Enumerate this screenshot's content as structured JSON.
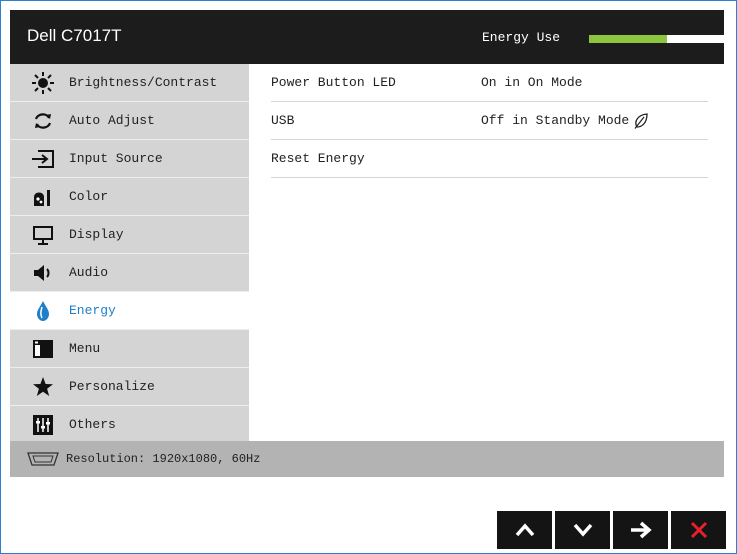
{
  "header": {
    "title": "Dell C7017T",
    "energy_use_label": "Energy Use",
    "energy_use_level": 0.58
  },
  "sidebar": {
    "items": [
      {
        "label": "Brightness/Contrast",
        "icon": "brightness-icon"
      },
      {
        "label": "Auto Adjust",
        "icon": "auto-adjust-icon"
      },
      {
        "label": "Input Source",
        "icon": "input-source-icon"
      },
      {
        "label": "Color",
        "icon": "color-icon"
      },
      {
        "label": "Display",
        "icon": "display-icon"
      },
      {
        "label": "Audio",
        "icon": "speaker-icon"
      },
      {
        "label": "Energy",
        "icon": "energy-drop-icon",
        "active": true
      },
      {
        "label": "Menu",
        "icon": "menu-icon"
      },
      {
        "label": "Personalize",
        "icon": "star-icon"
      },
      {
        "label": "Others",
        "icon": "sliders-icon"
      }
    ]
  },
  "energy_settings": [
    {
      "label": "Power Button LED",
      "value": "On in On Mode"
    },
    {
      "label": "USB",
      "value": "Off in Standby Mode",
      "value_icon": "leaf-icon"
    },
    {
      "label": "Reset Energy",
      "value": ""
    }
  ],
  "status": {
    "resolution_text": "Resolution: 1920x1080, 60Hz",
    "icon": "vga-connector-icon"
  },
  "nav_buttons": [
    {
      "name": "up",
      "icon": "chevron-up-icon",
      "color": "#ffffff"
    },
    {
      "name": "down",
      "icon": "chevron-down-icon",
      "color": "#ffffff"
    },
    {
      "name": "enter",
      "icon": "arrow-right-icon",
      "color": "#ffffff"
    },
    {
      "name": "exit",
      "icon": "close-icon",
      "color": "#e8202a"
    }
  ],
  "colors": {
    "accent": "#1f7fc8",
    "energy_bar": "#8cc63f",
    "title_bar": "#1c1c1c",
    "sidebar_bg": "#d4d4d4"
  }
}
